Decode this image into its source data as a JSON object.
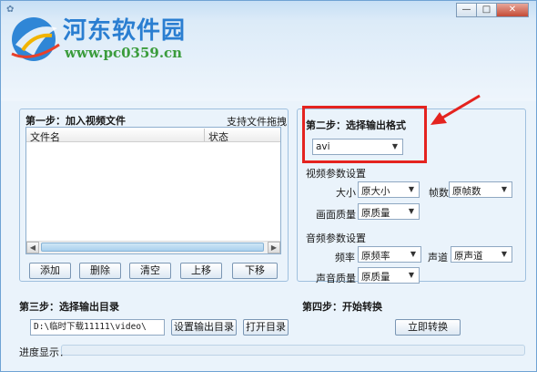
{
  "watermark": {
    "title": "河东软件园",
    "url": "www.pc0359.cn"
  },
  "window_controls": {
    "minimize": "—",
    "maximize": "□",
    "close": "✕"
  },
  "step1": {
    "title": "第一步：加入视频文件",
    "drag_hint": "支持文件拖拽",
    "columns": [
      "文件名",
      "状态"
    ],
    "buttons": {
      "add": "添加",
      "delete": "删除",
      "clear": "清空",
      "move_up": "上移",
      "move_down": "下移"
    }
  },
  "step2": {
    "title": "第二步：选择输出格式",
    "format": "avi",
    "video_section": "视频参数设置",
    "size_label": "大小",
    "size_value": "原大小",
    "fps_label": "帧数",
    "fps_value": "原帧数",
    "quality_label": "画面质量",
    "quality_value": "原质量",
    "audio_section": "音频参数设置",
    "freq_label": "频率",
    "freq_value": "原频率",
    "channel_label": "声道",
    "channel_value": "原声道",
    "audio_quality_label": "声音质量",
    "audio_quality_value": "原质量"
  },
  "step3": {
    "title": "第三步：选择输出目录",
    "path": "D:\\临时下载11111\\video\\",
    "set_dir_button": "设置输出目录",
    "open_dir_button": "打开目录"
  },
  "step4": {
    "title": "第四步：开始转换",
    "convert_button": "立即转换"
  },
  "progress": {
    "label": "进度显示：",
    "value": 0
  },
  "colors": {
    "accent_red": "#e4231f",
    "watermark_blue": "#2a7ed1",
    "watermark_green": "#3b9c3c"
  }
}
